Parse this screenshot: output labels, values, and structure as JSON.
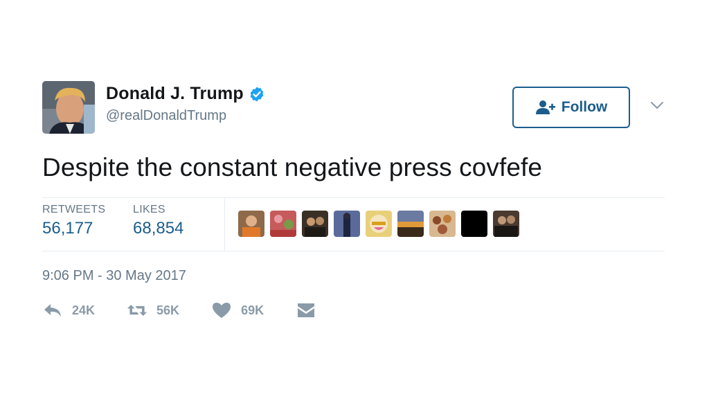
{
  "user": {
    "display_name": "Donald J. Trump",
    "handle": "@realDonaldTrump",
    "verified": true,
    "avatar_icon": "profile-photo"
  },
  "follow_button": {
    "label": "Follow",
    "icon": "add-user-icon"
  },
  "menu_icon": "chevron-down-icon",
  "tweet": {
    "text": "Despite the constant negative press covfefe",
    "timestamp": "9:06 PM - 30 May 2017"
  },
  "stats": {
    "retweets_label": "RETWEETS",
    "retweets_value": "56,177",
    "likes_label": "LIKES",
    "likes_value": "68,854"
  },
  "likers_count": 9,
  "actions": {
    "reply_count": "24K",
    "retweet_count": "56K",
    "like_count": "69K"
  },
  "colors": {
    "accent": "#1b5d8c",
    "verified": "#1da1f2",
    "muted": "#657786",
    "text": "#14171a"
  }
}
